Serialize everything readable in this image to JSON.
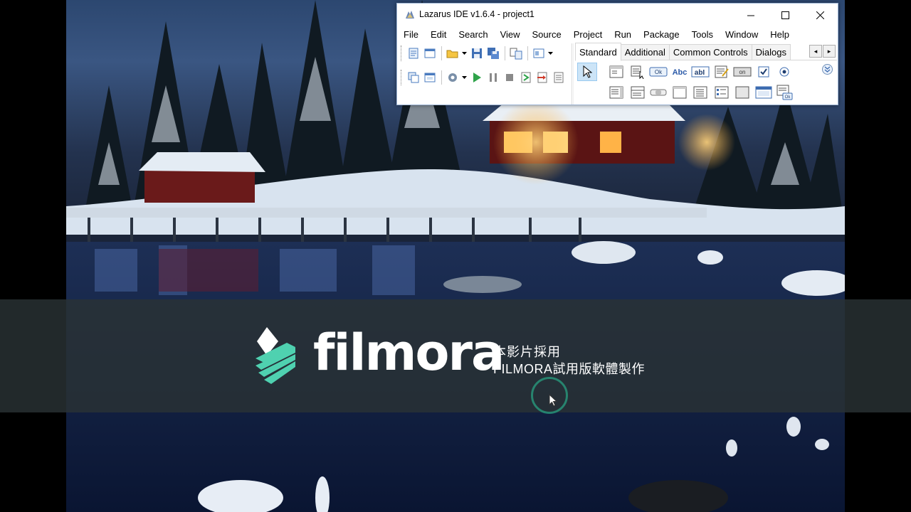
{
  "window": {
    "title": "Lazarus IDE v1.6.4 - project1",
    "controls": [
      "minimize",
      "maximize",
      "close"
    ]
  },
  "menu": [
    "File",
    "Edit",
    "Search",
    "View",
    "Source",
    "Project",
    "Run",
    "Package",
    "Tools",
    "Window",
    "Help"
  ],
  "toolbar": {
    "row1_icons": [
      "new-unit-icon",
      "new-form-icon",
      "open-icon",
      "save-icon",
      "save-all-icon",
      "toggle-form-unit-icon",
      "view-units-icon"
    ],
    "row2_icons": [
      "view-units-icon",
      "view-forms-icon",
      "change-build-mode-icon",
      "run-icon",
      "pause-icon",
      "stop-icon",
      "step-into-icon",
      "step-over-icon",
      "step-out-icon"
    ]
  },
  "palette": {
    "tabs": [
      {
        "label": "Standard",
        "active": true
      },
      {
        "label": "Additional",
        "active": false
      },
      {
        "label": "Common Controls",
        "active": false
      },
      {
        "label": "Dialogs",
        "active": false
      }
    ],
    "row1_components": [
      "TMainMenu",
      "TPopupMenu",
      "TButton",
      "TLabel",
      "TEdit",
      "TMemo",
      "TToggleBox",
      "TCheckBox",
      "TRadioButton"
    ],
    "row2_components": [
      "TListBox",
      "TComboBox",
      "TScrollBar",
      "TGroupBox",
      "TRadioGroup",
      "TCheckGroup",
      "TPanel",
      "TFrame",
      "TActionList"
    ],
    "button_caption": "Ok",
    "label_caption": "Abc",
    "edit_caption": "abI",
    "toggle_caption": "on"
  },
  "watermark": {
    "brand": "filmora",
    "line1": "本影片採用",
    "line2": "FILMORA試用版軟體製作"
  },
  "colors": {
    "accent": "#3d8ee0",
    "watermark_green": "#3fb59c"
  }
}
